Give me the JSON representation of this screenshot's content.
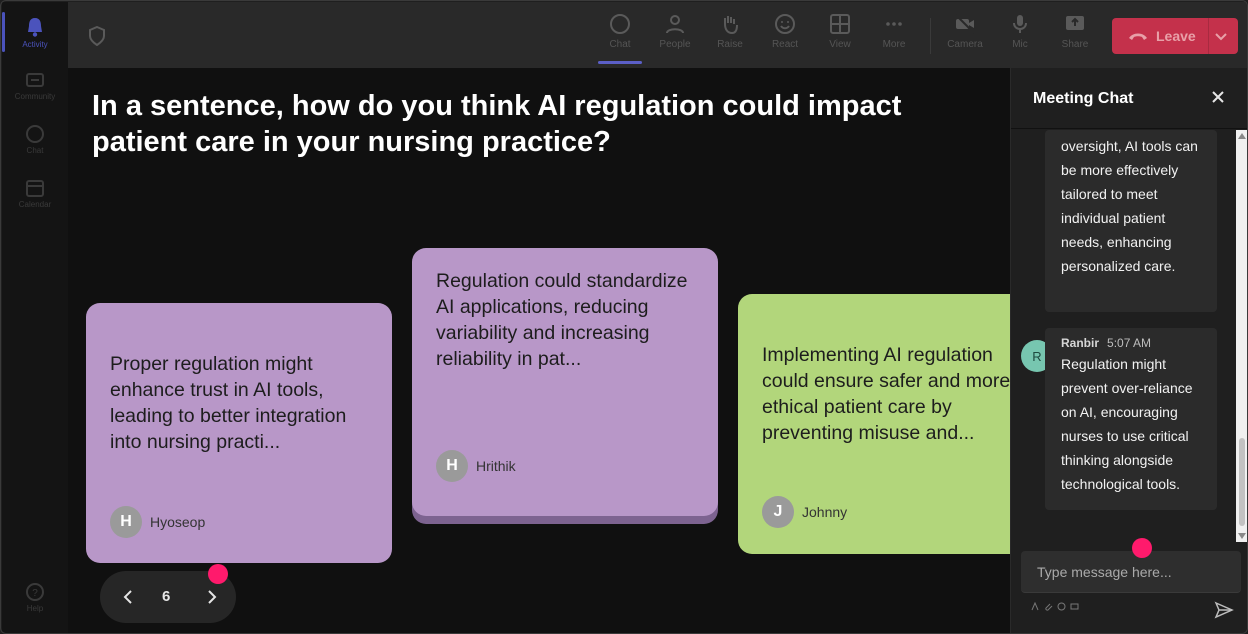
{
  "rail": [
    {
      "label": "Activity",
      "icon": "bell-icon",
      "active": true
    },
    {
      "label": "Community",
      "icon": "community-icon"
    },
    {
      "label": "Chat",
      "icon": "chat-icon"
    },
    {
      "label": "Calendar",
      "icon": "calendar-icon"
    },
    {
      "label": "Help",
      "icon": "help-icon"
    }
  ],
  "toolbar": {
    "chat": "Chat",
    "people": "People",
    "raise": "Raise",
    "react": "React",
    "view": "View",
    "more": "More",
    "camera": "Camera",
    "mic": "Mic",
    "share": "Share",
    "leave": "Leave"
  },
  "stage": {
    "question": "In a sentence, how do you think AI regulation could impact patient care in your nursing practice?",
    "cards": [
      {
        "text": "Proper regulation might enhance trust in AI tools, leading to better integration into nursing practi...",
        "initial": "H",
        "author": "Hyoseop"
      },
      {
        "text": "Regulation could standardize AI applications, reducing variability and increasing reliability in pat...",
        "initial": "H",
        "author": "Hrithik"
      },
      {
        "text": "Implementing AI regulation could ensure safer and more ethical patient care by preventing misuse and...",
        "initial": "J",
        "author": "Johnny"
      }
    ],
    "page": "6"
  },
  "chat": {
    "title": "Meeting Chat",
    "message1_text": "oversight, AI tools can be more effectively tailored to meet individual patient needs, enhancing personalized care.",
    "message2": {
      "initial": "R",
      "sender": "Ranbir",
      "time": "5:07 AM",
      "text": "Regulation might prevent over-reliance on AI, encouraging nurses to use critical thinking alongside technological tools."
    },
    "input_placeholder": "Type message here..."
  },
  "colors": {
    "card_purple": "#b897c8",
    "card_green": "#b2d67b",
    "leave_red": "#c4314b",
    "accent": "#5b5fc7",
    "pointer_dot": "#ff1a6c"
  }
}
